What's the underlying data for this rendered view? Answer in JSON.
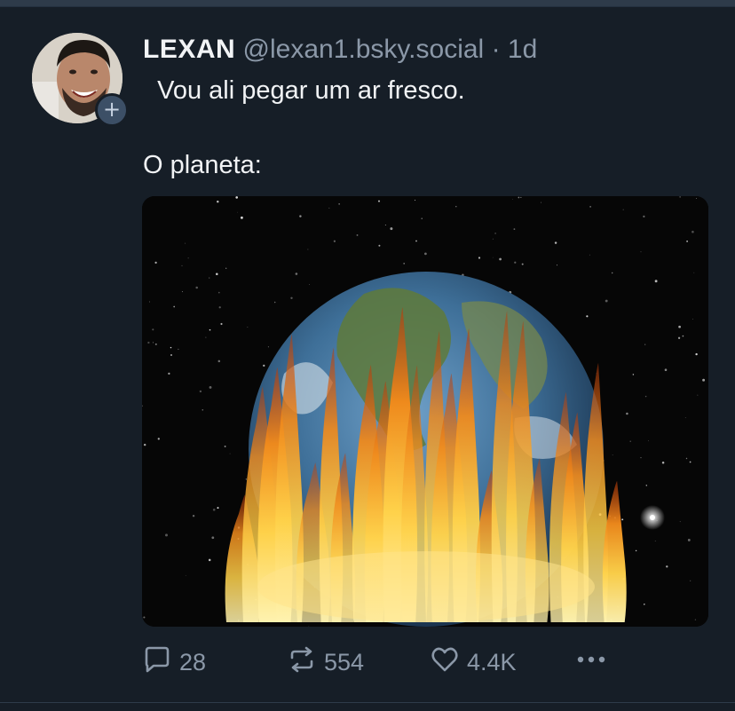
{
  "post": {
    "author": {
      "display_name": "LEXAN",
      "handle": "@lexan1.bsky.social",
      "separator": "·",
      "time": "1d",
      "follow_icon": "plus-icon"
    },
    "text_line1": "  Vou ali pegar um ar fresco.",
    "text_line2": "O planeta:",
    "media": {
      "icon": "burning-earth-image"
    },
    "actions": {
      "reply_count": "28",
      "repost_count": "554",
      "like_count": "4.4K",
      "reply_icon": "comment-icon",
      "repost_icon": "repost-icon",
      "like_icon": "heart-icon",
      "more_icon": "more-dots-icon"
    }
  },
  "colors": {
    "background": "#161e27",
    "text": "#f1f3f5",
    "muted": "#8b98a8",
    "border": "#2e3b4a"
  }
}
